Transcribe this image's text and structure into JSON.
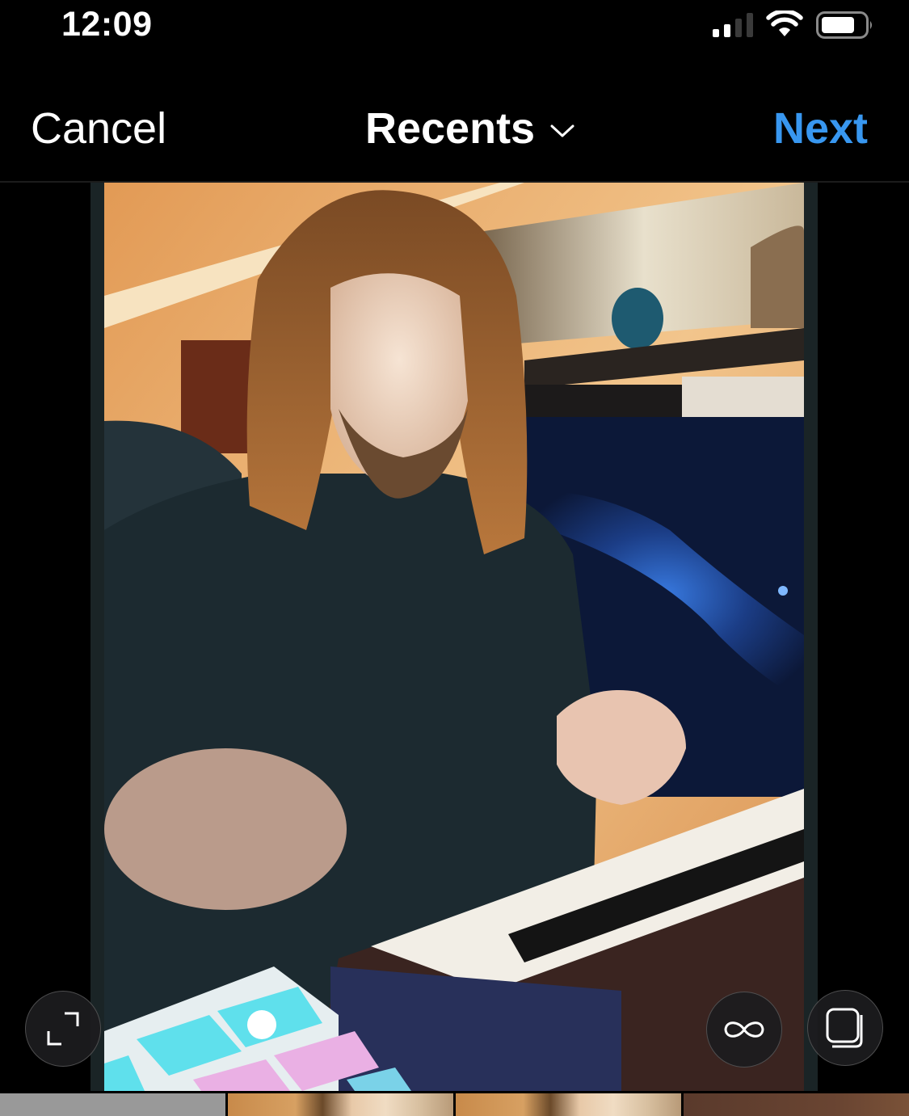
{
  "status_bar": {
    "time": "12:09",
    "signal_bars_active": 2,
    "signal_bars_total": 4,
    "wifi_icon": "wifi-icon",
    "battery_icon": "battery-icon"
  },
  "nav": {
    "cancel_label": "Cancel",
    "title": "Recents",
    "title_icon": "chevron-down-icon",
    "next_label": "Next",
    "next_color": "#3897F0"
  },
  "preview": {
    "image_alt": "Man with long hair playing a keyboard and pad controller in front of a galaxy backdrop",
    "controls": [
      {
        "name": "expand",
        "icon": "expand-icon"
      },
      {
        "name": "boomerang",
        "icon": "infinity-icon"
      },
      {
        "name": "select-multiple",
        "icon": "multiple-select-icon"
      }
    ]
  },
  "thumbnails": [
    {
      "alt": "Gray placeholder thumbnail"
    },
    {
      "alt": "Photo thumbnail of man with long hair"
    },
    {
      "alt": "Photo thumbnail of man with long hair"
    },
    {
      "alt": "Brown interior thumbnail"
    }
  ]
}
